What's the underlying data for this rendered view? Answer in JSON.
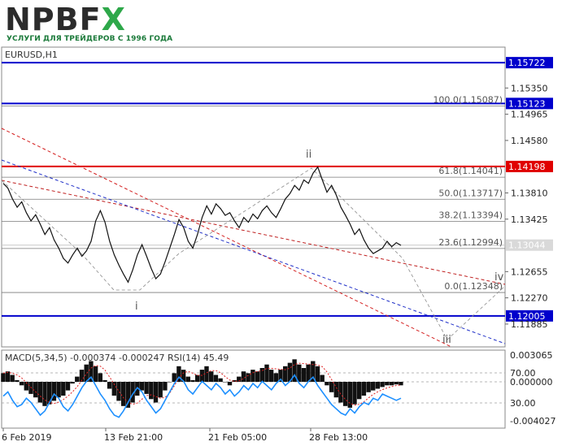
{
  "brand": {
    "logo_text_npb": "NPB",
    "logo_text_f": "F",
    "logo_text_x": "X",
    "subtitle": "УСЛУГИ ДЛЯ ТРЕЙДЕРОВ С 1996 ГОДА"
  },
  "chart_data": {
    "type": "line",
    "symbol_title": "EURUSD,H1",
    "price_axis": {
      "ylim": [
        1.1155,
        1.1595
      ],
      "ticks": [
        "1.15350",
        "1.14965",
        "1.14580",
        "1.13810",
        "1.13425",
        "1.12655",
        "1.12270",
        "1.11885"
      ],
      "tick_values": [
        1.1535,
        1.14965,
        1.1458,
        1.1381,
        1.13425,
        1.12655,
        1.1227,
        1.11885
      ]
    },
    "time_axis": {
      "ticks": [
        "6 Feb 2019",
        "13 Feb 21:00",
        "21 Feb 05:00",
        "28 Feb 13:00"
      ]
    },
    "horizontal_levels": [
      {
        "value": 1.15722,
        "label": "1.15722",
        "color": "#0000cc"
      },
      {
        "value": 1.15123,
        "label": "1.15123",
        "color": "#0000cc"
      },
      {
        "value": 1.14198,
        "label": "1.14198",
        "color": "#e00000"
      },
      {
        "value": 1.12005,
        "label": "1.12005",
        "color": "#0000cc"
      },
      {
        "value": 1.13044,
        "label": "1.13044",
        "color": "#c8c8c8"
      }
    ],
    "fibonacci": [
      {
        "label": "100.0(1.15087)",
        "value": 1.15087
      },
      {
        "label": "61.8(1.14041)",
        "value": 1.14041
      },
      {
        "label": "50.0(1.13717)",
        "value": 1.13717
      },
      {
        "label": "38.2(1.13394)",
        "value": 1.13394
      },
      {
        "label": "23.6(1.12994)",
        "value": 1.12994
      },
      {
        "label": "0.0(1.12348)",
        "value": 1.12348
      }
    ],
    "wave_labels": [
      "i",
      "ii",
      "iii",
      "iv"
    ],
    "price_series": {
      "name": "EURUSD",
      "values": [
        1.1395,
        1.1388,
        1.1372,
        1.136,
        1.1368,
        1.1352,
        1.134,
        1.1349,
        1.1335,
        1.132,
        1.133,
        1.1312,
        1.13,
        1.1285,
        1.1278,
        1.129,
        1.13,
        1.1288,
        1.1296,
        1.131,
        1.134,
        1.1355,
        1.1338,
        1.131,
        1.129,
        1.1275,
        1.1262,
        1.125,
        1.1268,
        1.129,
        1.1305,
        1.1288,
        1.127,
        1.1255,
        1.1262,
        1.128,
        1.13,
        1.132,
        1.1342,
        1.133,
        1.131,
        1.13,
        1.132,
        1.1345,
        1.1362,
        1.135,
        1.1365,
        1.1358,
        1.1348,
        1.1352,
        1.134,
        1.133,
        1.1345,
        1.1338,
        1.135,
        1.1343,
        1.1355,
        1.1362,
        1.1352,
        1.1345,
        1.1358,
        1.1372,
        1.138,
        1.1392,
        1.1385,
        1.14,
        1.1395,
        1.141,
        1.1419,
        1.14,
        1.1382,
        1.1392,
        1.1378,
        1.136,
        1.1348,
        1.1335,
        1.132,
        1.1328,
        1.1312,
        1.13,
        1.1292,
        1.1296,
        1.13,
        1.131,
        1.1302,
        1.1308,
        1.1304
      ]
    },
    "indicator": {
      "title": "MACD(5,34,5) -0.000374 -0.000247 RSI(14) 45.49",
      "macd_ticks": [
        "0.003065",
        "-0.004027"
      ],
      "rsi_ticks": [
        "70.00",
        "0.000000",
        "30.00"
      ],
      "rsi_values": [
        48,
        52,
        44,
        38,
        40,
        46,
        42,
        36,
        30,
        34,
        42,
        50,
        46,
        38,
        34,
        40,
        48,
        56,
        62,
        66,
        58,
        50,
        44,
        36,
        30,
        28,
        34,
        42,
        50,
        56,
        52,
        44,
        38,
        32,
        36,
        44,
        52,
        60,
        66,
        62,
        54,
        50,
        56,
        62,
        58,
        54,
        60,
        56,
        50,
        54,
        48,
        52,
        58,
        54,
        60,
        56,
        62,
        58,
        54,
        60,
        64,
        58,
        62,
        68,
        60,
        56,
        62,
        66,
        58,
        52,
        46,
        40,
        36,
        32,
        30,
        36,
        32,
        38,
        42,
        40,
        46,
        44,
        50,
        48,
        46,
        44,
        46
      ],
      "macd_values": [
        0.001,
        0.0012,
        0.0008,
        0.0002,
        -0.0004,
        -0.001,
        -0.0014,
        -0.0018,
        -0.0024,
        -0.0028,
        -0.0026,
        -0.0022,
        -0.0018,
        -0.0016,
        -0.001,
        -0.0002,
        0.0006,
        0.0014,
        0.002,
        0.0024,
        0.0018,
        0.001,
        0.0002,
        -0.0008,
        -0.0016,
        -0.0022,
        -0.0028,
        -0.003,
        -0.0024,
        -0.0016,
        -0.001,
        -0.0014,
        -0.002,
        -0.0024,
        -0.0018,
        -0.001,
        0.0,
        0.001,
        0.0018,
        0.0014,
        0.0006,
        0.0002,
        0.0008,
        0.0014,
        0.0018,
        0.0012,
        0.0008,
        0.0004,
        0.0,
        -0.0004,
        0.0002,
        0.0006,
        0.0012,
        0.001,
        0.0014,
        0.0012,
        0.0016,
        0.002,
        0.0014,
        0.001,
        0.0014,
        0.0018,
        0.0022,
        0.0026,
        0.002,
        0.0016,
        0.002,
        0.0024,
        0.0018,
        0.0008,
        -0.0004,
        -0.0012,
        -0.0018,
        -0.0024,
        -0.0028,
        -0.003,
        -0.0026,
        -0.002,
        -0.0016,
        -0.0012,
        -0.001,
        -0.0008,
        -0.0006,
        -0.0004,
        -0.0004,
        -0.0003,
        -0.0004
      ]
    }
  }
}
